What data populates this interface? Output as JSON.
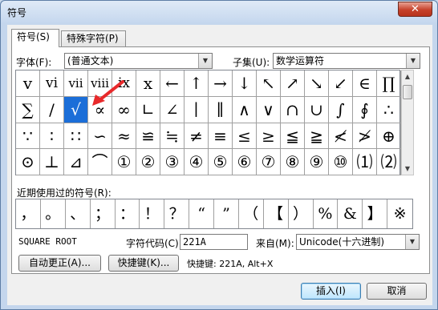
{
  "window": {
    "title": "符号",
    "close_label": "✕"
  },
  "tabs": [
    {
      "label": "符号(S)"
    },
    {
      "label": "特殊字符(P)"
    }
  ],
  "font": {
    "label": "字体(F):",
    "value": "(普通文本)"
  },
  "subset": {
    "label": "子集(U):",
    "value": "数学运算符"
  },
  "symbols": [
    [
      "v",
      "vi",
      "vii",
      "viii",
      "ix",
      "x",
      "←",
      "↑",
      "→",
      "↓",
      "↖",
      "↗",
      "↘",
      "↙",
      "∈",
      "∏"
    ],
    [
      "∑",
      "/",
      "√",
      "∝",
      "∞",
      "∟",
      "∠",
      "∣",
      "∥",
      "∧",
      "∨",
      "∩",
      "∪",
      "∫",
      "∮",
      "∴"
    ],
    [
      "∵",
      "∶",
      "∷",
      "∽",
      "≈",
      "≌",
      "≒",
      "≠",
      "≡",
      "≤",
      "≥",
      "≦",
      "≧",
      "≮",
      "≯",
      "⊕"
    ],
    [
      "⊙",
      "⊥",
      "⊿",
      "⌒",
      "①",
      "②",
      "③",
      "④",
      "⑤",
      "⑥",
      "⑦",
      "⑧",
      "⑨",
      "⑩",
      "⑴",
      "⑵"
    ]
  ],
  "selected_symbol": "√",
  "recent": {
    "label": "近期使用过的符号(R):",
    "items": [
      "，",
      "。",
      "、",
      "；",
      "：",
      "！",
      "？",
      "“",
      "”",
      "（",
      "【",
      "）",
      "%",
      "&",
      "】",
      "※"
    ]
  },
  "char_name": "SQUARE ROOT",
  "char_code": {
    "label": "字符代码(C):",
    "value": "221A"
  },
  "from": {
    "label": "来自(M):",
    "value": "Unicode(十六进制)"
  },
  "buttons": {
    "autocorrect": "自动更正(A)...",
    "shortcut_key": "快捷键(K)...",
    "insert": "插入(I)",
    "cancel": "取消"
  },
  "shortcut_info": "快捷键: 221A, Alt+X",
  "icons": {
    "arrow_annotation_color": "#e8292b",
    "selection_color": "#1b6ed8"
  }
}
